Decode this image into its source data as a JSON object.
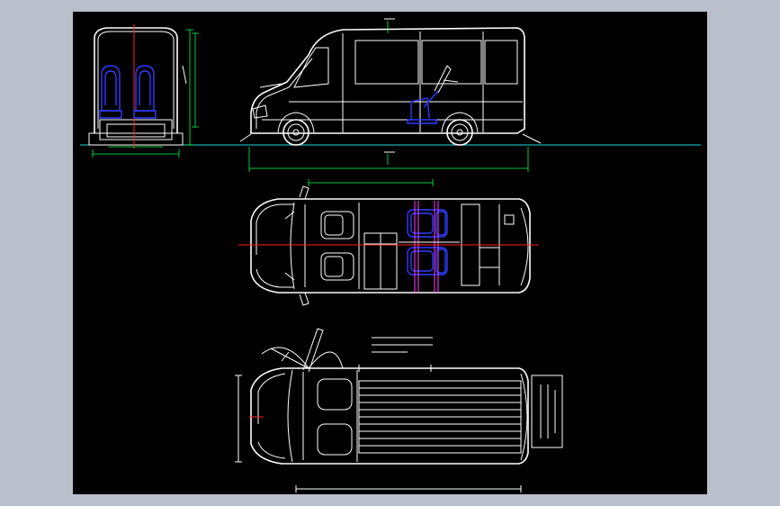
{
  "colors": {
    "background": "#000000",
    "frame": "#b9bfcb",
    "outline": "#ffffff",
    "dimension": "#00ff55",
    "ground_line": "#22d6e0",
    "centerline": "#ff2020",
    "seat": "#2f3cff",
    "seat_rail": "#ff40ff"
  },
  "views": {
    "front": "front-view",
    "side": "side-view",
    "top_seats": "top-view-seating",
    "top_cargo": "top-view-cargo"
  }
}
